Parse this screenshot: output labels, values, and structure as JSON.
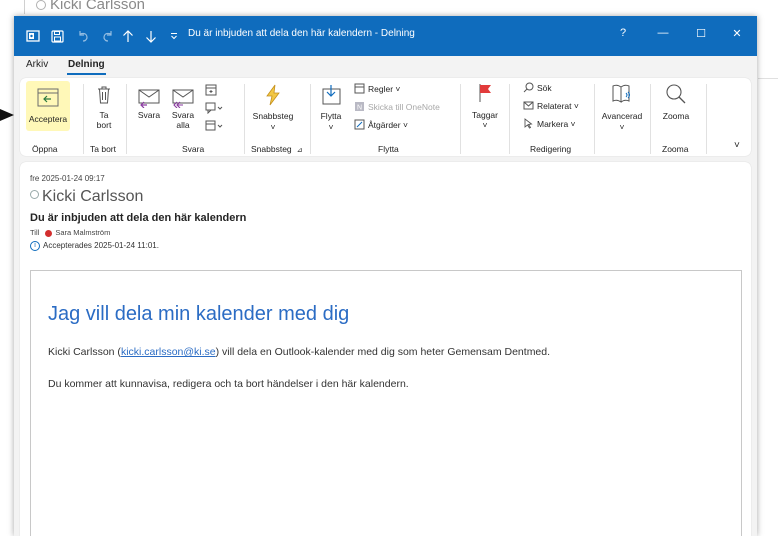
{
  "background": {
    "sender_name": "Kicki Carlsson"
  },
  "titlebar": {
    "title": "Du är inbjuden att dela den här kalendern - Delning",
    "help": "?",
    "minimize": "—",
    "maximize": "☐",
    "close": "✕"
  },
  "tabs": [
    {
      "label": "Arkiv"
    },
    {
      "label": "Delning"
    }
  ],
  "ribbon": {
    "accept": "Acceptera",
    "delete_line1": "Ta",
    "delete_line2": "bort",
    "reply": "Svara",
    "reply_all_line1": "Svara",
    "reply_all_line2": "alla",
    "quicksteps": "Snabbsteg",
    "move": "Flytta",
    "rules": "Regler ˅",
    "onenote": "Skicka till OneNote",
    "actions": "Åtgärder ˅",
    "tags": "Taggar",
    "search": "Sök",
    "related": "Relaterat ˅",
    "select": "Markera ˅",
    "advanced": "Avancerad",
    "zoom": "Zooma",
    "groups": {
      "open": "Öppna",
      "delete": "Ta bort",
      "respond": "Svara",
      "quicksteps": "Snabbsteg",
      "move": "Flytta",
      "editing": "Redigering",
      "zoom": "Zooma"
    }
  },
  "message": {
    "date": "fre 2025-01-24 09:17",
    "sender": "Kicki Carlsson",
    "subject": "Du är inbjuden att dela den här kalendern",
    "to_label": "Till",
    "recipient": "Sara Malmström",
    "info": "Accepterades 2025-01-24 11:01.",
    "headline": "Jag vill dela min kalender med dig",
    "body_prefix": "Kicki Carlsson (",
    "body_email": "kicki.carlsson@ki.se",
    "body_suffix": ") vill dela en Outlook-kalender med dig som heter Gemensam Dentmed.",
    "body_line2": "Du kommer att kunnavisa, redigera och ta bort händelser i den här kalendern."
  },
  "colors": {
    "titlebar": "#0f6cbd",
    "accept_highlight": "#fff8b8",
    "link": "#2b6cc4",
    "status_dot": "#d32f2f"
  }
}
